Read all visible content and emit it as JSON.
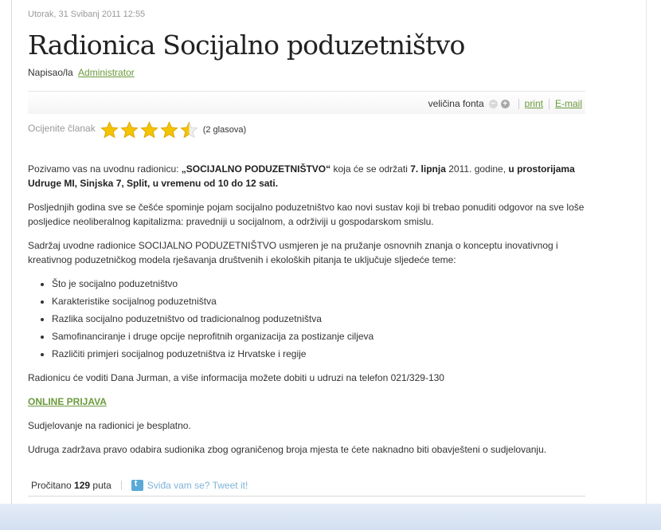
{
  "article": {
    "date": "Utorak, 31 Svibanj 2011 12:55",
    "title": "Radionica Socijalno poduzetništvo",
    "author_prefix": "Napisao/la",
    "author_name": "Administrator"
  },
  "toolbar": {
    "font_size_label": "veličina fonta",
    "decrease_symbol": "−",
    "increase_symbol": "+",
    "print_label": "print",
    "email_label": "E-mail"
  },
  "rating": {
    "label": "Ocijenite članak",
    "score": 4.5,
    "max": 5,
    "votes_text": "(2 glasova)"
  },
  "content": {
    "p1_a": "Pozivamo vas na uvodnu radionicu: ",
    "p1_b": "„SOCIJALNO PODUZETNIŠTVO“",
    "p1_c": " koja će se održati ",
    "p1_d": "7. lipnja",
    "p1_e": " 2011. godine, ",
    "p1_f": "u prostorijama Udruge MI, Sinjska 7, Split, u vremenu od 10 do 12 sati.",
    "p2": "Posljednjih godina sve se češće spominje pojam socijalno poduzetništvo kao novi sustav koji bi trebao ponuditi odgovor na sve loše posljedice neoliberalnog kapitalizma: pravedniji u socijalnom, a održiviji u gospodarskom smislu.",
    "p3": "Sadržaj uvodne radionice SOCIJALNO PODUZETNIŠTVO usmjeren je na pružanje osnovnih znanja o konceptu inovativnog i kreativnog poduzetničkog modela rješavanja društvenih i ekoloških pitanja te uključuje sljedeće teme:",
    "topics": [
      "Što je socijalno poduzetništvo",
      "Karakteristike socijalnog poduzetništva",
      "Razlika socijalno poduzetništvo od tradicionalnog poduzetništva",
      "Samofinanciranje i druge opcije neprofitnih organizacija za postizanje ciljeva",
      "Različiti primjeri socijalnog poduzetništva iz Hrvatske i regije"
    ],
    "p4": "Radionicu će voditi Dana Jurman, a više informacija možete dobiti u udruzi na telefon 021/329-130",
    "online_link": "ONLINE PRIJAVA",
    "p5": "Sudjelovanje na radionici je besplatno.",
    "p6": "Udruga zadržava pravo odabira sudionika zbog ograničenog broja mjesta te ćete naknadno biti obavješteni o sudjelovanju."
  },
  "footer": {
    "read_prefix": "Pročitano",
    "read_count": "129",
    "read_suffix": "puta",
    "tweet_label": "Sviđa vam se? Tweet it!"
  },
  "colors": {
    "link_green": "#6b9a3c",
    "star_gold": "#f5c400",
    "tweet_blue": "#7db4d8",
    "bottom_band": "#dce6f4"
  }
}
